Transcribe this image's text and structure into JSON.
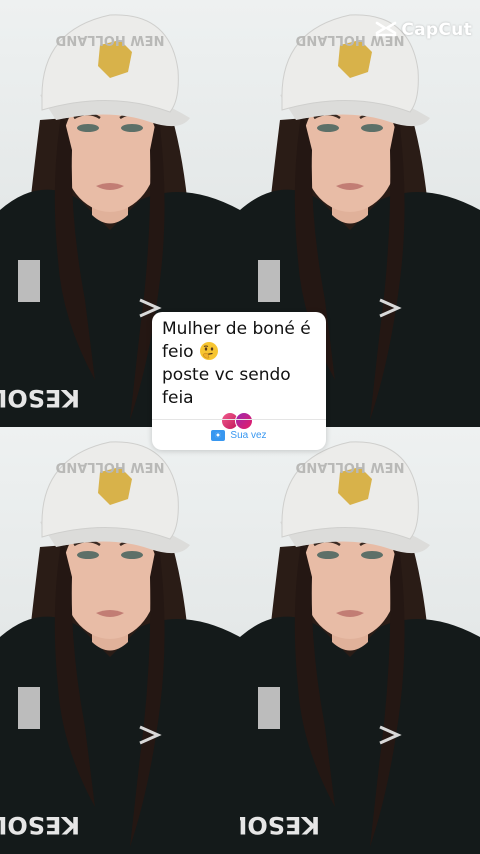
{
  "watermark": {
    "brand": "CapCut",
    "icon": "capcut-logo-icon"
  },
  "tiles": [
    {
      "cap_text": "NEW HOLLAND",
      "shirt_text": "KESOL"
    },
    {
      "cap_text": "NEW HOLLAND",
      "shirt_text": "KESOL"
    },
    {
      "cap_text": "NEW HOLLAND",
      "shirt_text": "KESOL"
    },
    {
      "cap_text": "NEW HOLLAND",
      "shirt_text": "KESOL"
    }
  ],
  "sticker": {
    "line1": "Mulher de boné é",
    "line2": "feio",
    "line2_emoji": "thinking-face-emoji",
    "line3": "poste vc sendo feia",
    "participant_avatars": 2,
    "cta": "Sua vez",
    "cta_icon": "camera-icon",
    "colors": {
      "cta": "#3897f0",
      "background": "#ffffff"
    }
  }
}
